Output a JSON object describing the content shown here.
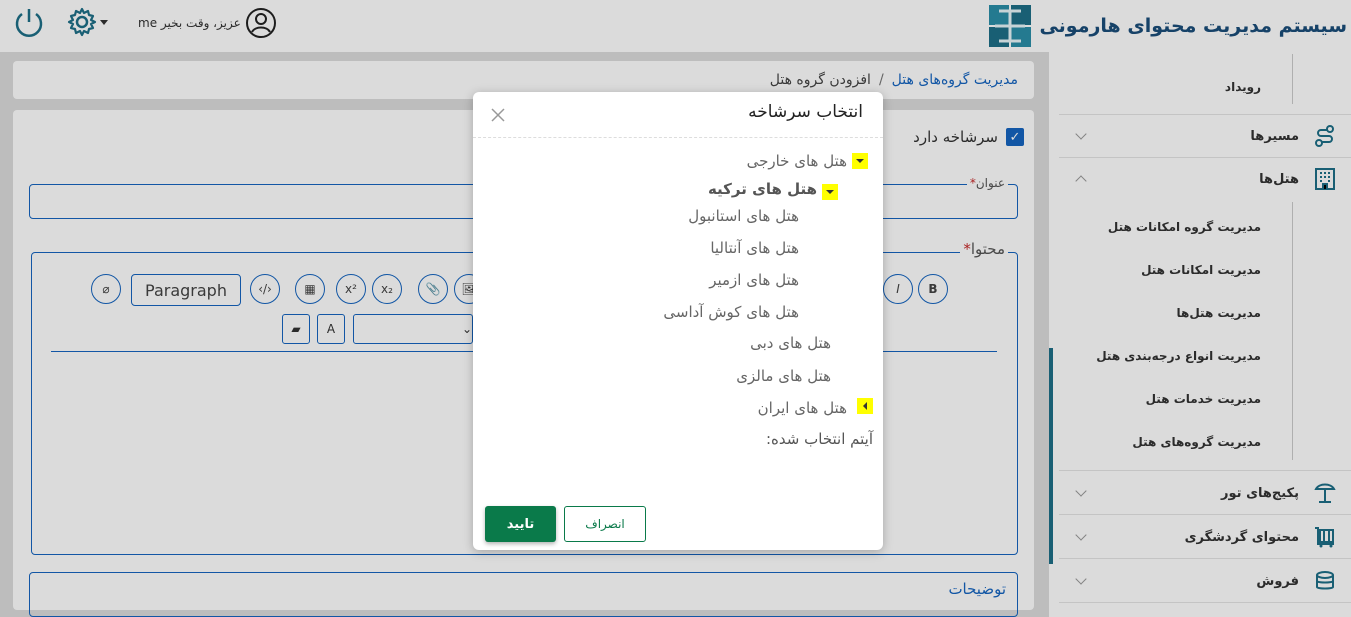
{
  "header": {
    "brand_title": "سیستم مدیریت محتوای هارمونی",
    "user_name": "me",
    "greeting": "عزیز، وقت بخیر"
  },
  "breadcrumb": {
    "parent": "مدیریت گروه‌های هتل",
    "separator": "/",
    "current": "افزودن گروه هتل"
  },
  "form": {
    "has_parent_label": "سرشاخه دارد",
    "title_label": "عنوان",
    "content_label": "محتوا",
    "description_label": "توضیحات",
    "required_mark": "*",
    "paragraph_label": "Paragraph",
    "superscript": "x²",
    "subscript": "x₂",
    "italic": "I",
    "bold": "B"
  },
  "sidebar": {
    "event_label": "رویداد",
    "routes_label": "مسیرها",
    "hotels_label": "هتل‌ها",
    "hotel_subitems": [
      "مدیریت گروه امکانات هتل",
      "مدیریت امکانات هتل",
      "مدیریت هتل‌ها",
      "مدیریت انواع درجه‌بندی هتل",
      "مدیریت خدمات هتل",
      "مدیریت گروه‌های هتل"
    ],
    "tour_packages_label": "پکیج‌های تور",
    "tourism_content_label": "محتوای گردشگری",
    "sales_label": "فروش"
  },
  "modal": {
    "title": "انتخاب سرشاخه",
    "tree": {
      "foreign": "هتل های خارجی",
      "turkey": "هتل های ترکیه",
      "istanbul": "هتل های استانبول",
      "antalya": "هتل های آنتالیا",
      "izmir": "هتل های ازمیر",
      "kusadasi": "هتل های کوش آداسی",
      "dubai": "هتل های دبی",
      "malaysia": "هتل های مالزی",
      "iran": "هتل های ایران"
    },
    "selected_item_label": "آیتم انتخاب شده:",
    "confirm_label": "تایید",
    "cancel_label": "انصراف"
  },
  "colors": {
    "accent": "#1565c0",
    "confirm": "#0a7a4a",
    "toggle_highlight": "#ffff00"
  }
}
